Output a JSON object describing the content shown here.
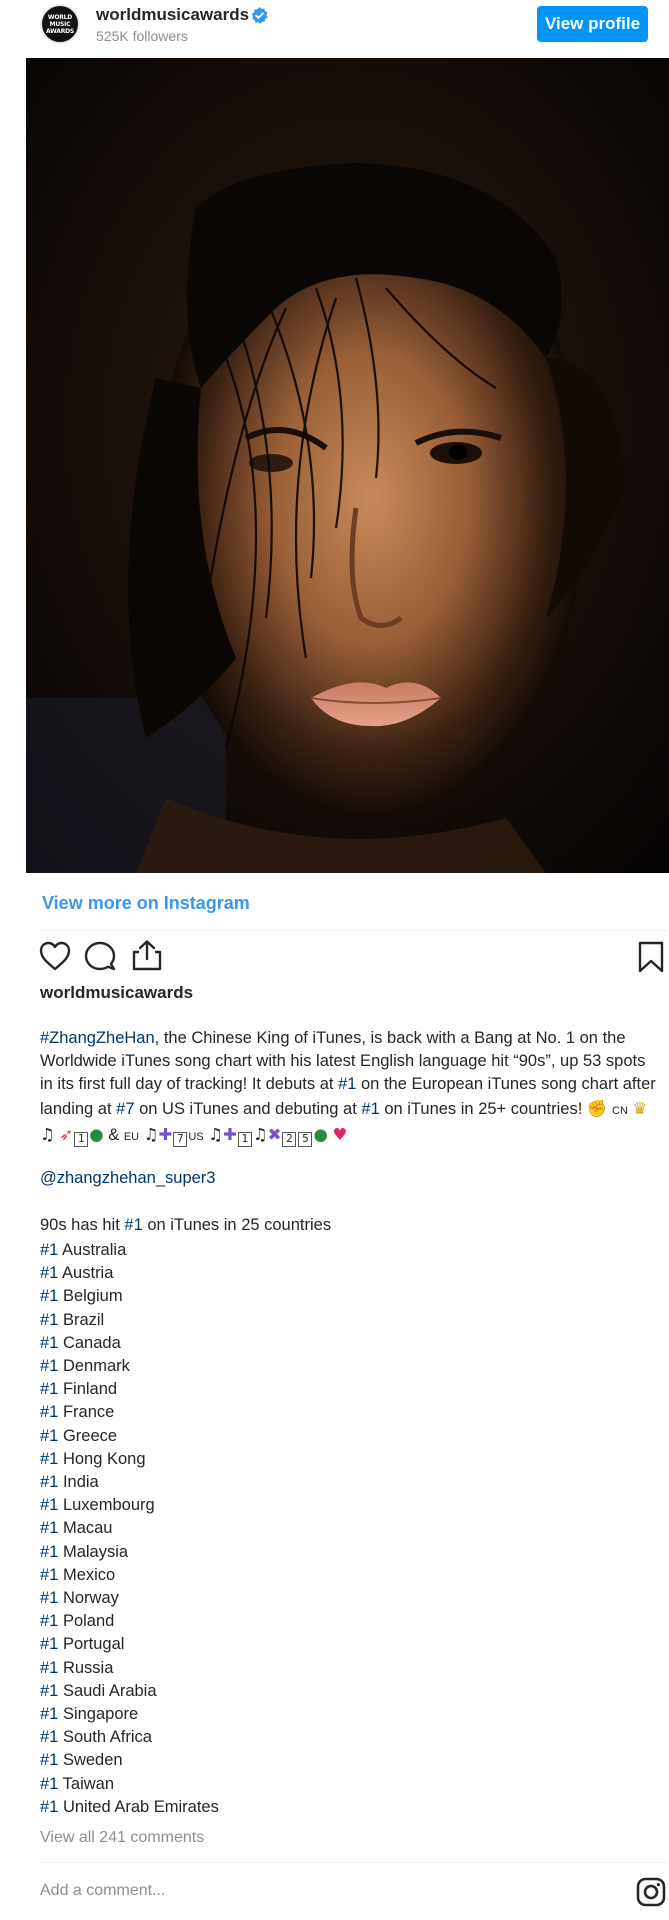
{
  "header": {
    "avatar_text": [
      "WORLD",
      "MUSIC",
      "AWARDS"
    ],
    "username": "worldmusicawards",
    "followers": "525K followers",
    "view_profile_label": "View profile"
  },
  "view_more_label": "View more on Instagram",
  "post": {
    "username": "worldmusicawards",
    "caption": {
      "hashtag_main": "#ZhangZheHan",
      "text_1": ", the Chinese King of iTunes, is back with a Bang at No. 1 on the Worldwide iTunes song chart with his latest English language hit “90s”, up 53 spots in its first full day of tracking! It debuts at ",
      "tag_1": "#1",
      "text_2": " on the European iTunes song chart after landing at ",
      "tag_7": "#7",
      "text_3": " on US iTunes and debuting at ",
      "tag_1b": "#1",
      "text_4": " on iTunes in 25+ countries! ",
      "emoji_tail_cn": "CN",
      "emoji_tail_eu": "EU",
      "emoji_tail_us": "US",
      "box_1": "1",
      "box_7": "7",
      "box_1b": "1",
      "box_2": "2",
      "box_5": "5"
    },
    "mention": "@zhangzhehan_super3",
    "list_intro_a": "90s has hit ",
    "list_intro_tag": "#1",
    "list_intro_b": " on iTunes in 25 countries",
    "rank_tag": "#1",
    "countries": [
      "Australia",
      "Austria",
      "Belgium",
      "Brazil",
      "Canada",
      "Denmark",
      "Finland",
      "France",
      "Greece",
      "Hong Kong",
      "India",
      "Luxembourg",
      "Macau",
      "Malaysia",
      "Mexico",
      "Norway",
      "Poland",
      "Portugal",
      "Russia",
      "Saudi Arabia",
      "Singapore",
      "South Africa",
      "Sweden",
      "Taiwan",
      "United Arab Emirates"
    ],
    "view_comments": "View all 241 comments",
    "add_comment_placeholder": "Add a comment..."
  },
  "colors": {
    "accent": "#0095f6",
    "link": "#3897f0",
    "hashtag": "#00376b",
    "muted": "#8e8e8e"
  },
  "icons": [
    "verified-badge-icon",
    "heart-icon",
    "comment-icon",
    "share-icon",
    "bookmark-icon",
    "instagram-logo-icon"
  ]
}
